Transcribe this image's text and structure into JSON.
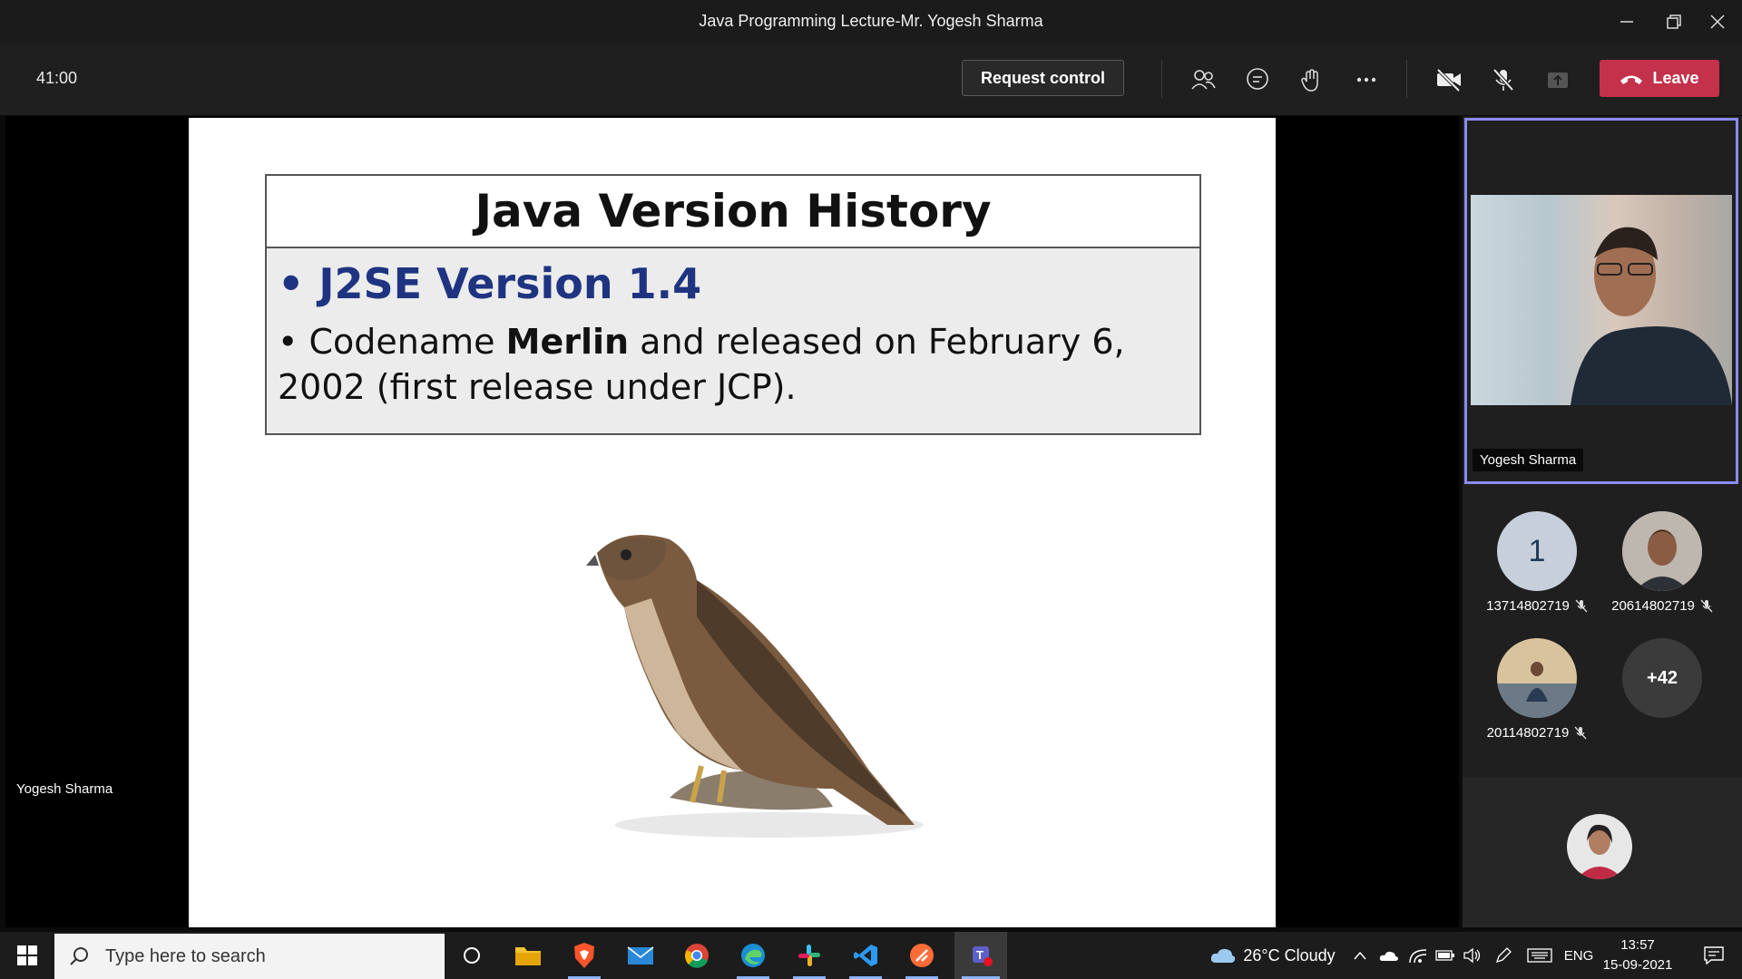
{
  "window": {
    "title": "Java Programming Lecture-Mr. Yogesh Sharma"
  },
  "toolbar": {
    "timer": "41:00",
    "request_control_label": "Request control",
    "leave_label": "Leave",
    "icons": [
      "people-icon",
      "chat-icon",
      "raise-hand-icon",
      "more-icon",
      "camera-off-icon",
      "mic-off-icon",
      "share-tray-icon",
      "phone-icon"
    ]
  },
  "slide": {
    "title": "Java Version History",
    "bullet1": "J2SE Version 1.4",
    "bullet2_prefix": "Codename ",
    "bullet2_bold": "Merlin",
    "bullet2_suffix": " and released on February 6, 2002 (first release under JCP).",
    "presenter_label": "Yogesh Sharma"
  },
  "panel": {
    "video_name": "Yogesh Sharma",
    "participants": [
      {
        "avatar_text": "1",
        "label": "13714802719"
      },
      {
        "avatar_text": "",
        "label": "20614802719"
      },
      {
        "avatar_text": "",
        "label": "20114802719"
      },
      {
        "avatar_text": "+42",
        "label": ""
      }
    ]
  },
  "taskbar": {
    "search_placeholder": "Type here to search",
    "weather": "26°C  Cloudy",
    "language": "ENG",
    "time": "13:57",
    "date": "15-09-2021"
  },
  "colors": {
    "leave": "#c4314b",
    "active_border": "#8b8cf0",
    "slide_heading_blue": "#1f3481"
  }
}
